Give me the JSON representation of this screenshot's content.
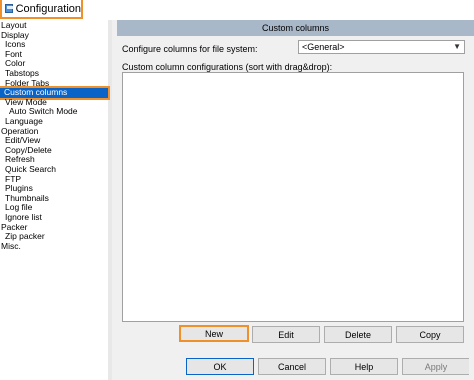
{
  "window": {
    "title": "Configuration"
  },
  "tree": {
    "items": [
      {
        "label": "Layout",
        "indent": 0
      },
      {
        "label": "Display",
        "indent": 0
      },
      {
        "label": "Icons",
        "indent": 1
      },
      {
        "label": "Font",
        "indent": 1
      },
      {
        "label": "Color",
        "indent": 1
      },
      {
        "label": "Tabstops",
        "indent": 1
      },
      {
        "label": "Folder Tabs",
        "indent": 1
      },
      {
        "label": "Custom columns",
        "indent": 1,
        "selected": true
      },
      {
        "label": "View Mode",
        "indent": 1
      },
      {
        "label": "Auto Switch Mode",
        "indent": 2
      },
      {
        "label": "Language",
        "indent": 1
      },
      {
        "label": "Operation",
        "indent": 0
      },
      {
        "label": "Edit/View",
        "indent": 1
      },
      {
        "label": "Copy/Delete",
        "indent": 1
      },
      {
        "label": "Refresh",
        "indent": 1
      },
      {
        "label": "Quick Search",
        "indent": 1
      },
      {
        "label": "FTP",
        "indent": 1
      },
      {
        "label": "Plugins",
        "indent": 1
      },
      {
        "label": "Thumbnails",
        "indent": 1
      },
      {
        "label": "Log file",
        "indent": 1
      },
      {
        "label": "Ignore list",
        "indent": 1
      },
      {
        "label": "Packer",
        "indent": 0
      },
      {
        "label": "Zip packer",
        "indent": 1
      },
      {
        "label": "Misc.",
        "indent": 0
      }
    ]
  },
  "panel": {
    "header": "Custom columns",
    "fs_label": "Configure columns for file system:",
    "fs_value": "<General>",
    "list_label": "Custom column configurations (sort with drag&drop):"
  },
  "buttons": {
    "new": "New",
    "edit": "Edit",
    "delete": "Delete",
    "copy": "Copy",
    "ok": "OK",
    "cancel": "Cancel",
    "help": "Help",
    "apply": "Apply"
  },
  "colors": {
    "highlight_outline": "#f0902a",
    "selection": "#0a64c8",
    "header_bg": "#a9b8c9"
  }
}
